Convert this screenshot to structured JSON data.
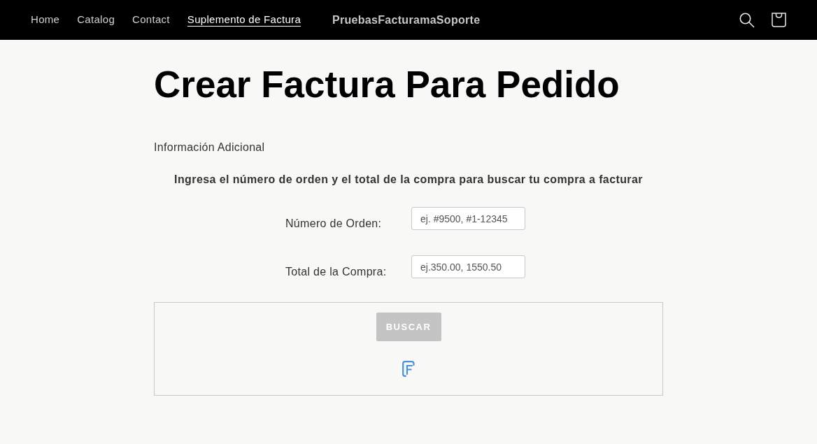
{
  "header": {
    "nav_links": [
      {
        "label": "Home",
        "selected": false
      },
      {
        "label": "Catalog",
        "selected": false
      },
      {
        "label": "Contact",
        "selected": false
      },
      {
        "label": "Suplemento de Factura",
        "selected": true
      }
    ],
    "brand": "PruebasFacturamaSoporte"
  },
  "main": {
    "title": "Crear Factura Para Pedido",
    "section_label": "Información Adicional",
    "instructions": "Ingresa el número de orden y el total de la compra para buscar tu compra a facturar",
    "fields": [
      {
        "label": "Número de Orden:",
        "placeholder": "ej. #9500, #1-12345"
      },
      {
        "label": "Total de la Compra:",
        "placeholder": "ej.350.00, 1550.50"
      }
    ],
    "search_button": {
      "label": "BUSCAR",
      "disabled": true
    }
  }
}
